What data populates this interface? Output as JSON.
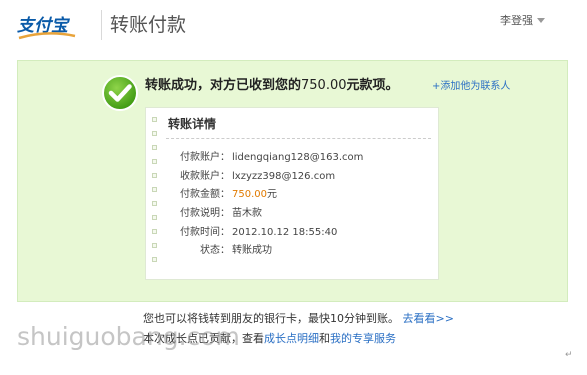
{
  "header": {
    "logo_text": "支付宝",
    "title": "转账付款",
    "user": "李登强"
  },
  "result": {
    "message_prefix": "转账成功，对方已收到您的",
    "amount": "750.00",
    "message_suffix": "元款项。",
    "add_contact": "+添加他为联系人"
  },
  "details": {
    "title": "转账详情",
    "rows": [
      {
        "label": "付款账户：",
        "value": "lidengqiang128@163.com"
      },
      {
        "label": "收款账户：",
        "value": "lxzyzz398@126.com"
      },
      {
        "label": "付款金额：",
        "value": "750.00",
        "unit": "元"
      },
      {
        "label": "付款说明：",
        "value": "苗木款"
      },
      {
        "label": "付款时间：",
        "value": "2012.10.12 18:55:40"
      },
      {
        "label": "状态：",
        "value": "转账成功"
      }
    ]
  },
  "footer": {
    "line1_text": "您也可以将钱转到朋友的银行卡，最快10分钟到账。",
    "line1_link": "去看看>>",
    "line2_text": "本次成长点已贡献，查看",
    "line2_link1": "成长点明细",
    "line2_and": "和",
    "line2_link2": "我的专享服务"
  },
  "watermark": "shuiguobang.com",
  "colors": {
    "accent_green_bg": "#e8f8d5",
    "link_blue": "#2a6fc4",
    "money_orange": "#e07a00",
    "logo_blue": "#0a5aa8"
  }
}
